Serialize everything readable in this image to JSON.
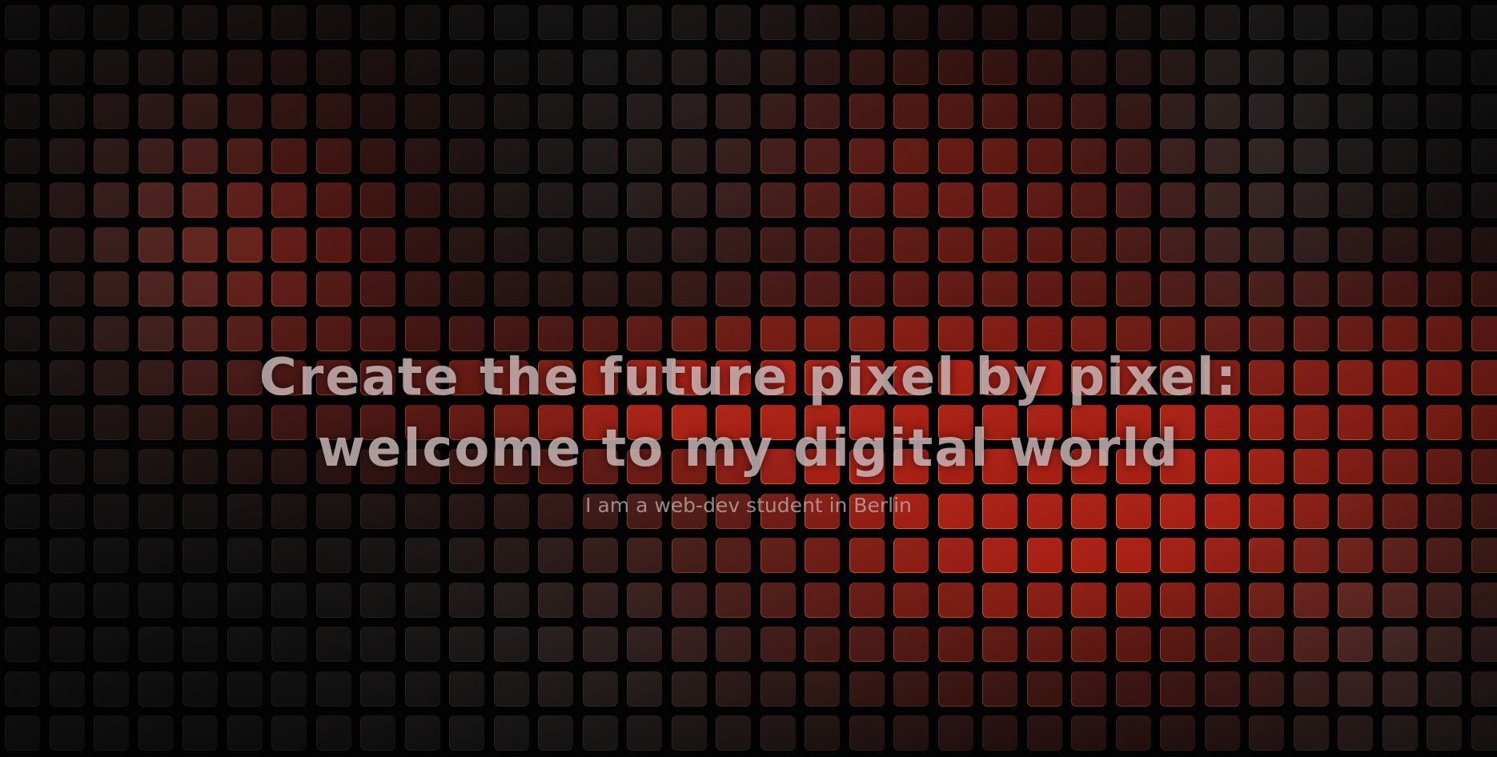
{
  "hero": {
    "title_line1": "Create the future pixel by pixel:",
    "title_line2": "welcome to my digital world",
    "subtitle": "I am a web-dev student in Berlin"
  },
  "colors": {
    "background": "#050505",
    "tile_dark": "#1f1f1f",
    "tile_red": "#6e1a10",
    "tile_bright_red": "#c22a14",
    "title_text": "#d6c4c4"
  }
}
